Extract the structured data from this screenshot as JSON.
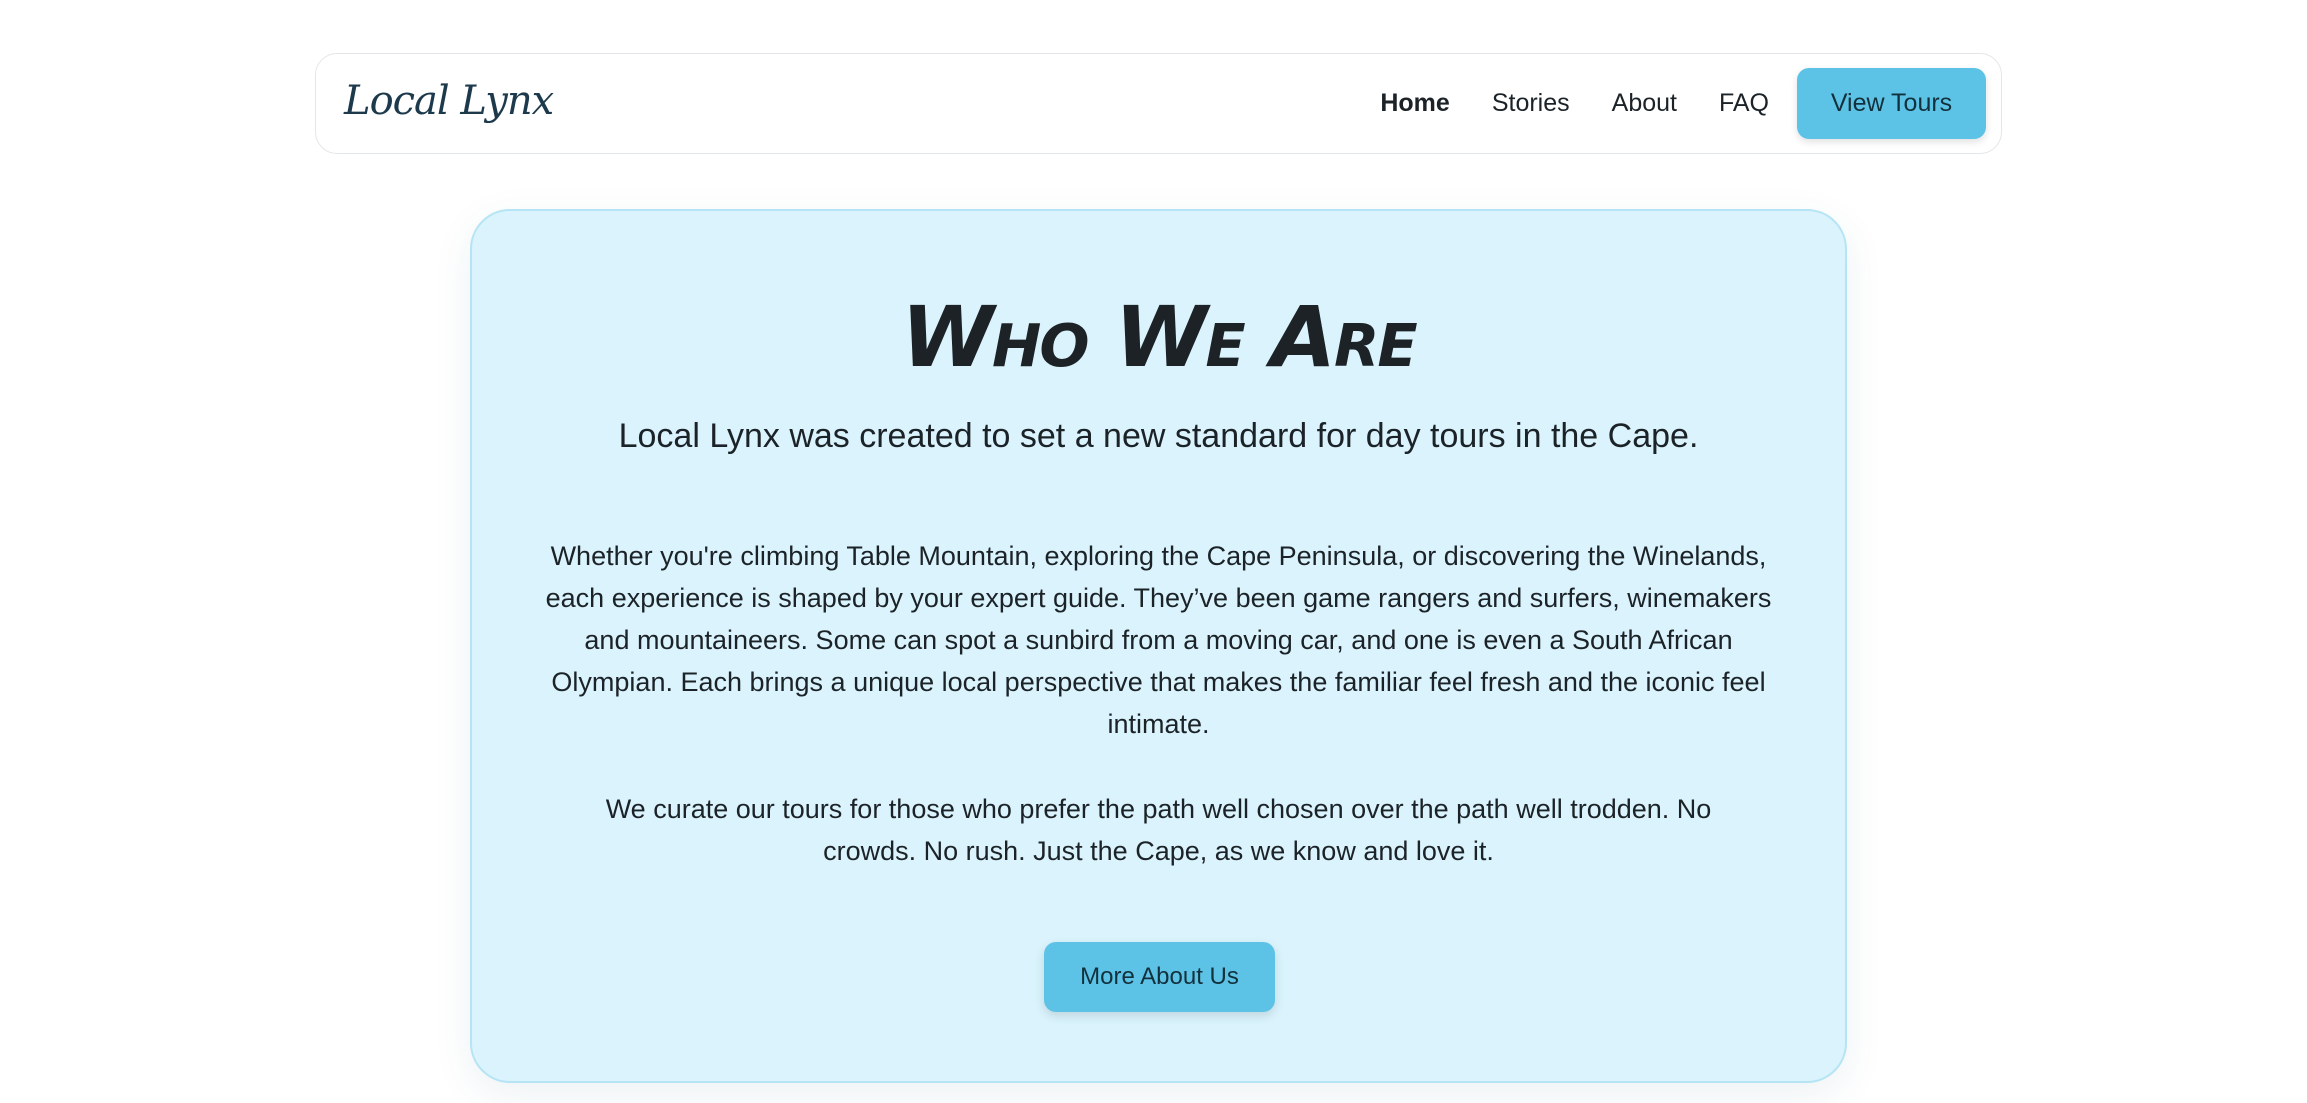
{
  "header": {
    "brand": "Local Lynx",
    "nav": {
      "home": "Home",
      "stories": "Stories",
      "about": "About",
      "faq": "FAQ"
    },
    "cta": "View Tours"
  },
  "about": {
    "title": "Who We Are",
    "lead": "Local Lynx was created to set a new standard for day tours in the Cape.",
    "paragraph1": "Whether you're climbing Table Mountain, exploring the Cape Peninsula, or discovering the Winelands, each experience is shaped by your expert guide. They’ve been game rangers and surfers, winemakers and mountaineers. Some can spot a sunbird from a moving car, and one is even a South African Olympian. Each brings a unique local perspective that makes the familiar feel fresh and the iconic feel intimate.",
    "paragraph2": "We curate our tours for those who prefer the path well chosen over the path well trodden. No crowds. No rush. Just the Cape, as we know and love it.",
    "button": "More About Us"
  },
  "colors": {
    "accent": "#5cc3e6",
    "card_background": "#daf3fc",
    "card_border": "#b5e4f4",
    "brand_text": "#1d3a4c"
  }
}
